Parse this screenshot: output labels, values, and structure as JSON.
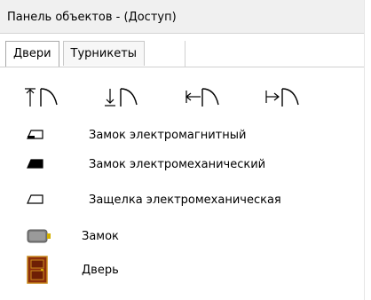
{
  "panel": {
    "title": "Панель объектов - (Доступ)"
  },
  "tabs": [
    {
      "label": "Двери",
      "active": true
    },
    {
      "label": "Турникеты",
      "active": false
    }
  ],
  "door_icons": [
    {
      "name": "door-opens-up-icon"
    },
    {
      "name": "door-opens-down-icon"
    },
    {
      "name": "door-opens-left-icon"
    },
    {
      "name": "door-opens-right-icon"
    }
  ],
  "items": [
    {
      "label": "Замок электромагнитный",
      "icon": "electromagnetic-lock-icon"
    },
    {
      "label": "Замок электромеханический",
      "icon": "electromechanical-lock-icon"
    },
    {
      "label": "Защелка электромеханическая",
      "icon": "electromechanical-latch-icon"
    },
    {
      "label": "Замок",
      "icon": "lock-icon"
    },
    {
      "label": "Дверь",
      "icon": "door-icon"
    }
  ],
  "colors": {
    "titlebar": "#f0f0f0",
    "door_icon_fill": "#8b2d0c",
    "door_icon_border": "#c98a1c",
    "lock_icon": "#7a7a7a"
  }
}
